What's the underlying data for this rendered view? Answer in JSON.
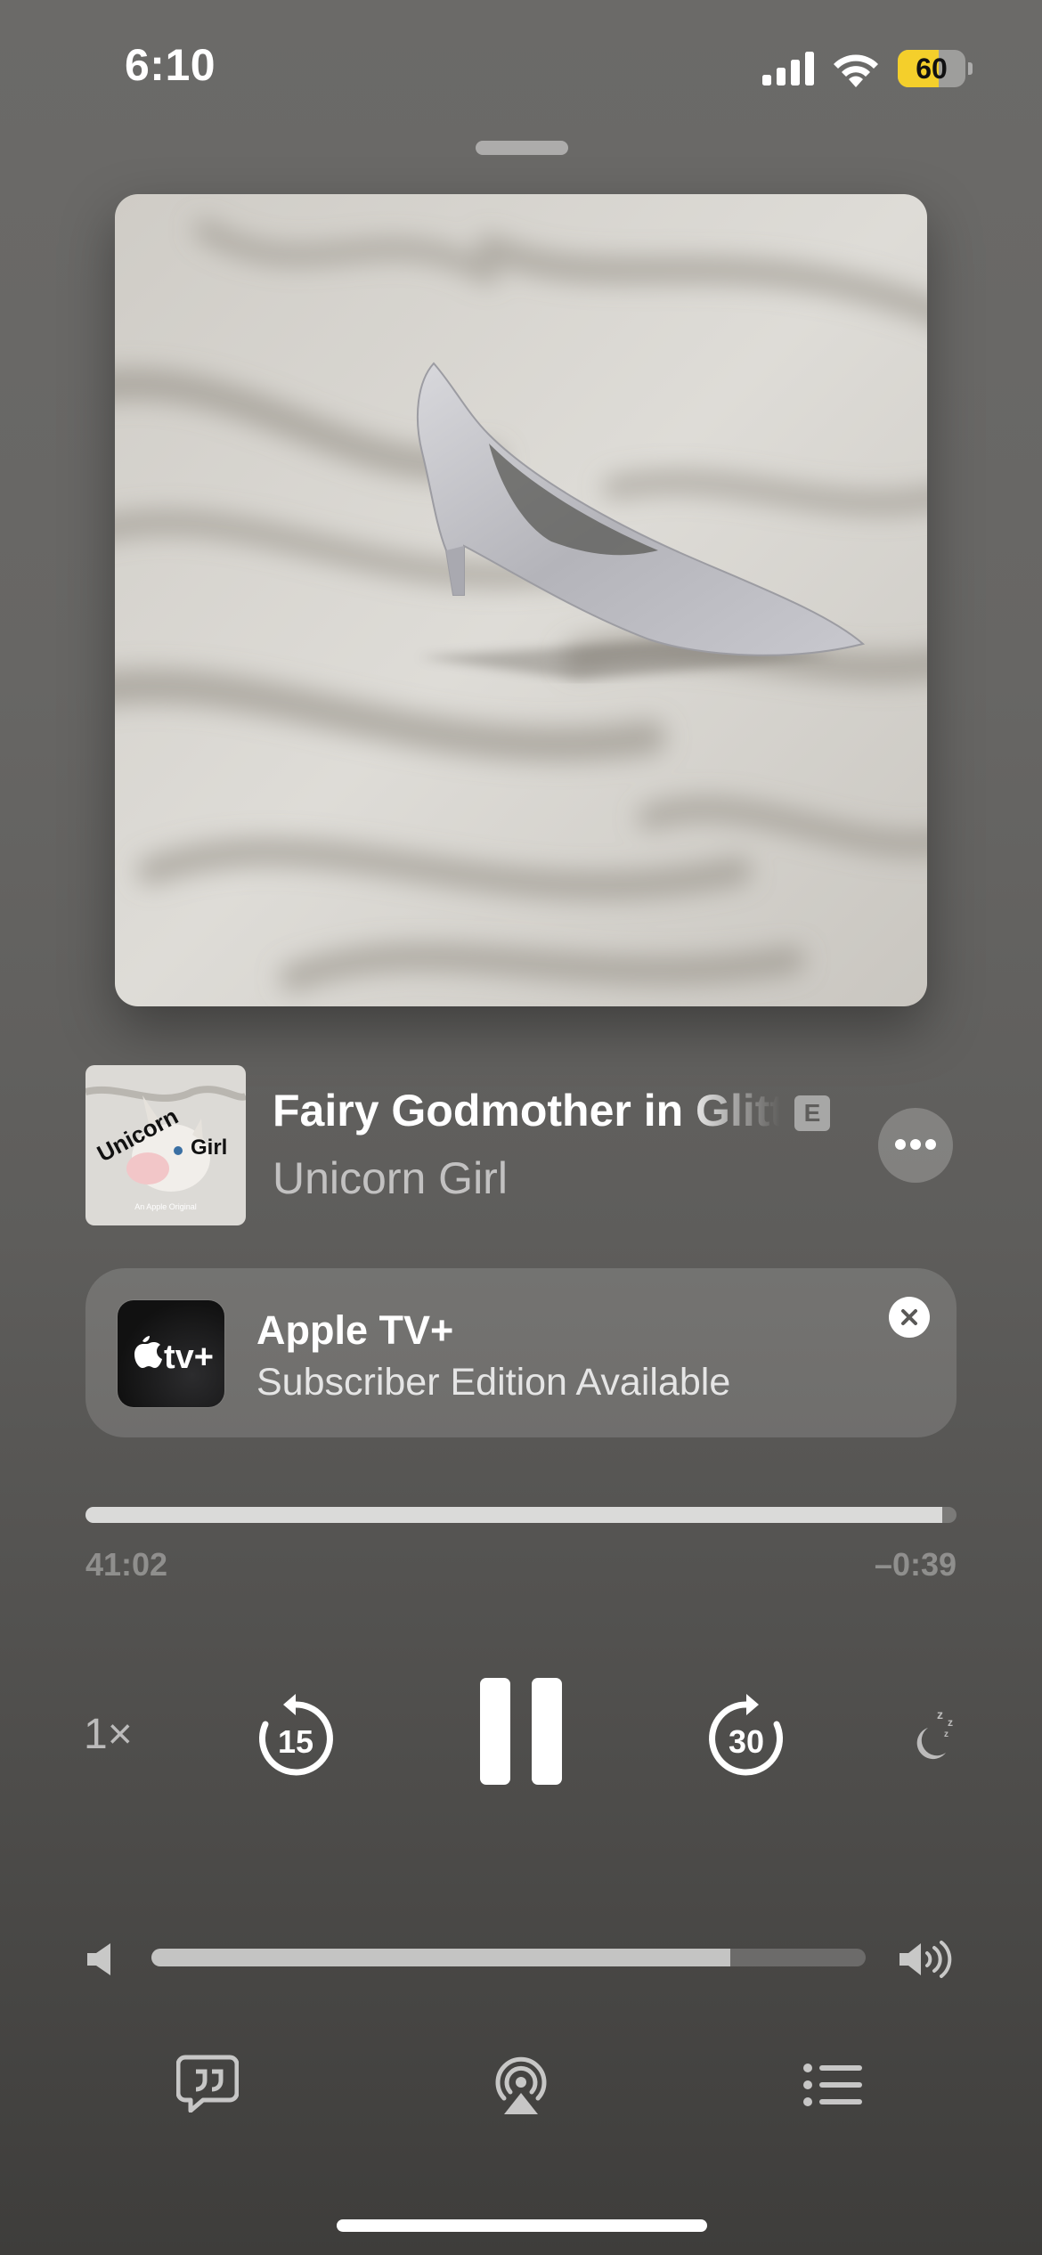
{
  "status_bar": {
    "time": "6:10",
    "battery_level": "60",
    "icons": [
      "cellular-signal-icon",
      "wifi-icon",
      "battery-icon"
    ]
  },
  "now_playing": {
    "artwork_icon": "glitter-high-heel-artwork",
    "episode_title": "Fairy Godmother in Glitt",
    "explicit_badge": "E",
    "show_name": "Unicorn Girl",
    "show_thumb": {
      "title_word_1": "Unicorn",
      "title_word_2": "Girl",
      "caption": "An Apple Original"
    }
  },
  "promo": {
    "icon_label": "tv+",
    "title": "Apple TV+",
    "subtitle": "Subscriber Edition Available"
  },
  "playback": {
    "elapsed": "41:02",
    "remaining": "–0:39",
    "progress_fraction": 0.984,
    "speed": "1×",
    "skip_back_seconds": "15",
    "skip_forward_seconds": "30"
  },
  "volume": {
    "level_fraction": 0.81
  },
  "colors": {
    "battery_fill": "#f4cf2b",
    "background_top": "#6b6a68",
    "background_bottom": "#3e3d3b"
  }
}
